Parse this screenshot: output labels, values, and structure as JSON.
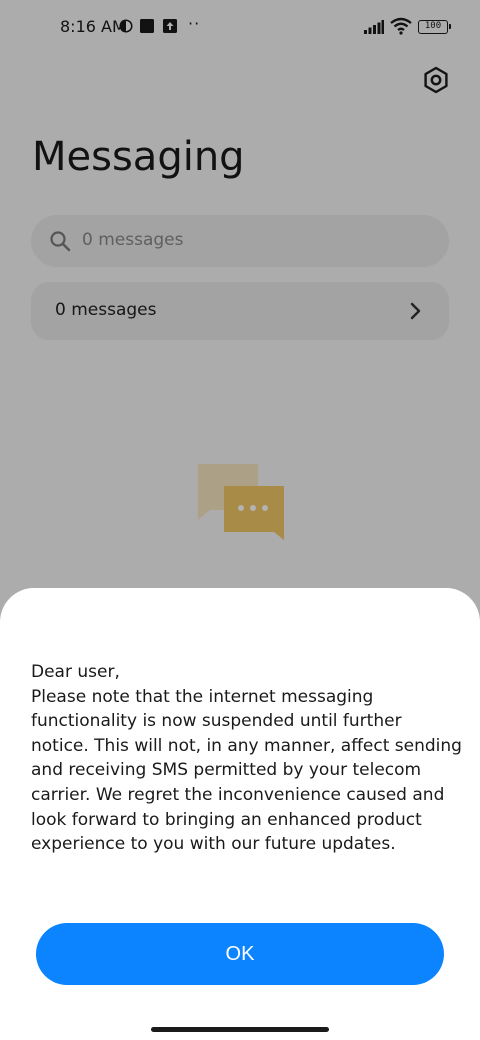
{
  "status_bar": {
    "time": "8:16 AM",
    "overflow": "··",
    "battery": "100"
  },
  "app": {
    "title": "Messaging",
    "search_placeholder": "0 messages",
    "row_label": "0 messages"
  },
  "dialog": {
    "lines": [
      "Dear user,",
      "Please note that the internet messaging",
      "functionality is now suspended until further",
      "notice. This will not, in any manner, affect sending",
      "and receiving SMS permitted by your telecom",
      "carrier. We regret the inconvenience caused and",
      "look forward to bringing an enhanced product",
      "experience to you with our future updates."
    ],
    "ok_label": "OK"
  },
  "icons": [
    "settings-icon",
    "search-icon",
    "chevron-right-icon",
    "empty-messages-icon",
    "signal-icon",
    "wifi-icon",
    "battery-icon"
  ],
  "colors": {
    "accent": "#0d84ff",
    "empty_illustration": "#f3c867"
  }
}
